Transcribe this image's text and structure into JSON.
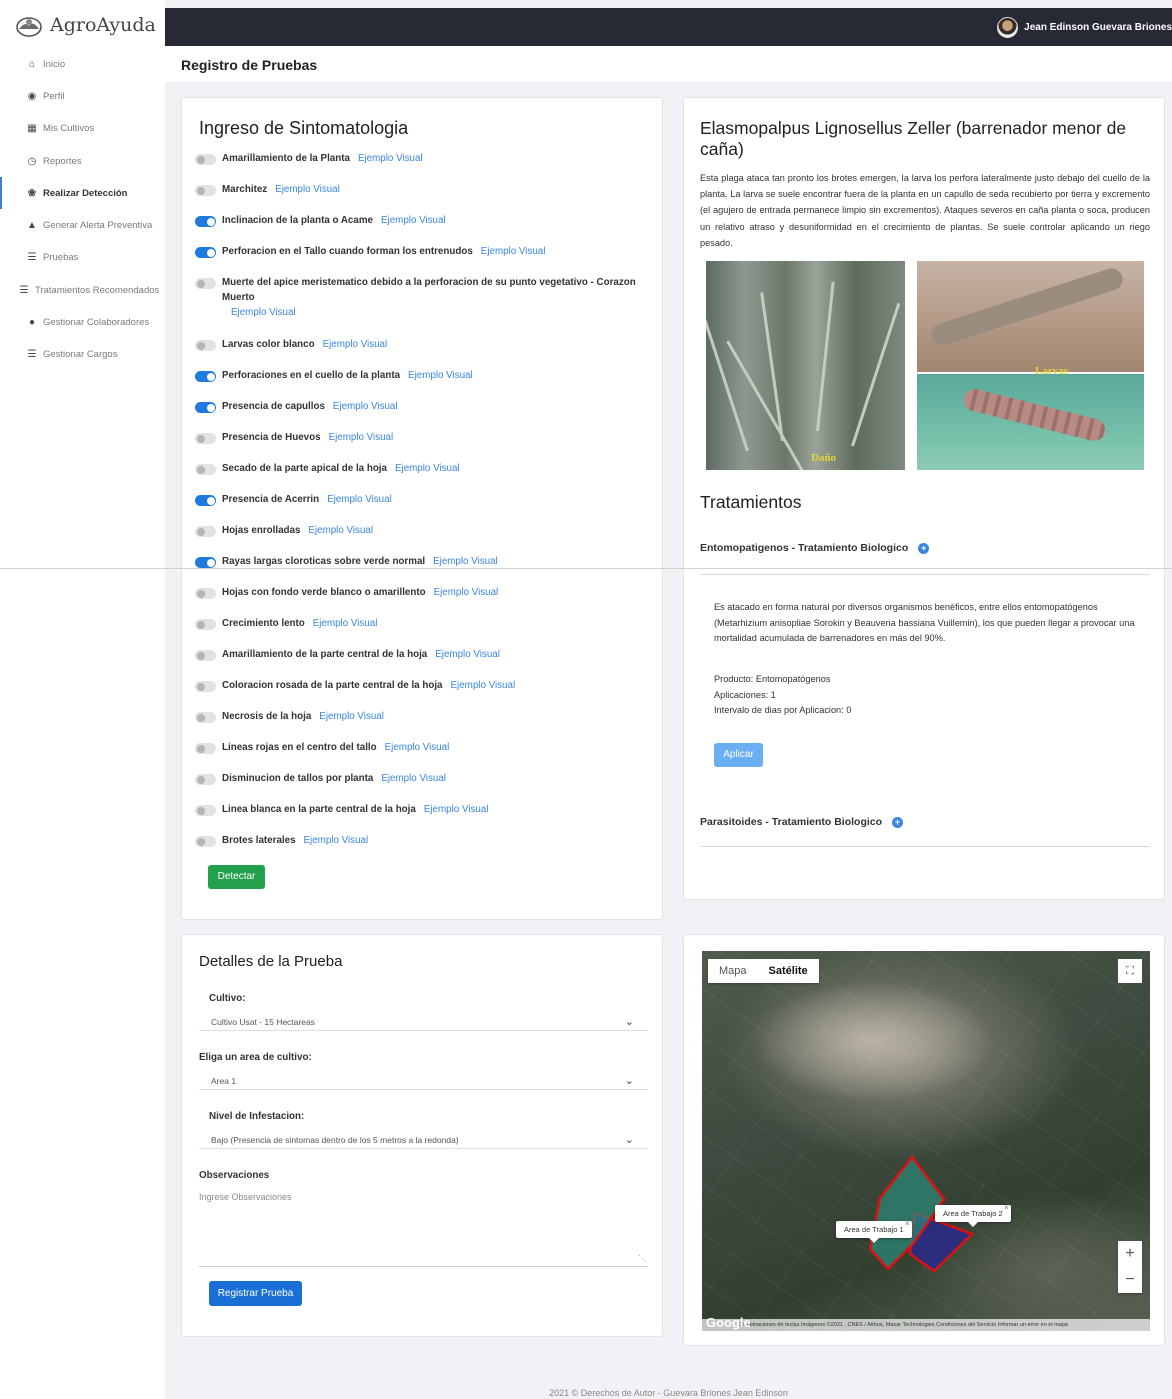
{
  "app": {
    "name": "AgroAyuda"
  },
  "user": {
    "name": "Jean Edinson Guevara Briones"
  },
  "sidebar": {
    "items": [
      {
        "label": "Inicio",
        "icon": "home-icon"
      },
      {
        "label": "Perfil",
        "icon": "user-circle-icon"
      },
      {
        "label": "Mis Cultivos",
        "icon": "map-icon"
      },
      {
        "label": "Reportes",
        "icon": "clock-icon"
      },
      {
        "label": "Realizar Detección",
        "icon": "bug-icon",
        "active": true
      },
      {
        "label": "Generar Alerta Preventiva",
        "icon": "bell-icon"
      },
      {
        "label": "Pruebas",
        "icon": "list-icon"
      },
      {
        "label": "Tratamientos Recomendados",
        "icon": "list-icon"
      },
      {
        "label": "Gestionar Colaboradores",
        "icon": "user-icon"
      },
      {
        "label": "Gestionar Cargos",
        "icon": "list-icon"
      }
    ]
  },
  "page": {
    "title": "Registro de Pruebas"
  },
  "symptoms": {
    "title": "Ingreso de Sintomatologia",
    "link_label": "Ejemplo Visual",
    "items": [
      {
        "label": "Amarillamiento de la Planta",
        "on": false
      },
      {
        "label": "Marchitez",
        "on": false
      },
      {
        "label": "Inclinacion de la planta o Acame",
        "on": true
      },
      {
        "label": "Perforacion en el Tallo cuando forman los entrenudos",
        "on": true
      },
      {
        "label": "Muerte del apice meristematico debido a la perforacion de su punto vegetativo - Corazon Muerto",
        "on": false
      },
      {
        "label": "Larvas color blanco",
        "on": false
      },
      {
        "label": "Perforaciones en el cuello de la planta",
        "on": true
      },
      {
        "label": "Presencia de capullos",
        "on": true
      },
      {
        "label": "Presencia de Huevos",
        "on": false
      },
      {
        "label": "Secado de la parte apical de la hoja",
        "on": false
      },
      {
        "label": "Presencia de Acerrin",
        "on": true
      },
      {
        "label": "Hojas enrolladas",
        "on": false
      },
      {
        "label": "Rayas largas cloroticas sobre verde normal",
        "on": true
      },
      {
        "label": "Hojas con fondo verde blanco o amarillento",
        "on": false
      },
      {
        "label": "Crecimiento lento",
        "on": false
      },
      {
        "label": "Amarillamiento de la parte central de la hoja",
        "on": false
      },
      {
        "label": "Coloracion rosada de la parte central de la hoja",
        "on": false
      },
      {
        "label": "Necrosis de la hoja",
        "on": false
      },
      {
        "label": "Lineas rojas en el centro del tallo",
        "on": false
      },
      {
        "label": "Disminucion de tallos por planta",
        "on": false
      },
      {
        "label": "Linea blanca en la parte central de la hoja",
        "on": false
      },
      {
        "label": "Brotes laterales",
        "on": false
      }
    ],
    "detect_label": "Detectar"
  },
  "pest": {
    "title": "Elasmopalpus Lignosellus Zeller (barrenador menor de caña)",
    "description": "Esta plaga ataca tan pronto los brotes emergen, la larva los perfora lateralmente justo debajo del cuello de la planta. La larva se suele encontrar fuera de la planta en un capullo de seda recubierto por tierra y excremento (el agujero de entrada permanece limpio sin excrementos). Ataques severos en caña planta o soca, producen un relativo atraso y desuniformidad en el crecimiento de plantas. Se suele controlar aplicando un riego pesado.",
    "photo_labels": {
      "damage": "Daño",
      "larvae": "Larvas"
    },
    "treatments_title": "Tratamientos",
    "treatments": [
      {
        "name": "Entomopatigenos - Tratamiento Biologico",
        "body": "Es atacado en forma natural por diversos organismos benéficos, entre ellos entomopatógenos (Metarhizium anisopliae Sorokin y Beauveria bassiana Vuillemin), los que pueden llegar a provocar una mortalidad acumulada de barrenadores en más del 90%.",
        "producto": "Producto: Entomopatógenos",
        "aplicaciones": "Aplicaciones: 1",
        "intervalo": "Intervalo de dias por Aplicacion: 0",
        "apply_label": "Aplicar"
      },
      {
        "name": "Parasitoides - Tratamiento Biologico"
      }
    ]
  },
  "details": {
    "title": "Detalles de la Prueba",
    "cultivo_label": "Cultivo:",
    "cultivo_value": "Cultivo Usat - 15 Hectareas",
    "area_label": "Eliga un area de cultivo:",
    "area_value": "Area 1",
    "nivel_label": "Nivel de Infestacion:",
    "nivel_value": "Bajo (Presencia de sintomas dentro de los 5 metros a la redonda)",
    "obs_label": "Observaciones",
    "obs_placeholder": "Ingrese Observaciones",
    "submit_label": "Registrar Prueba"
  },
  "map": {
    "tab_map": "Mapa",
    "tab_satellite": "Satélite",
    "zoom_in": "+",
    "zoom_out": "−",
    "google": "Google",
    "attribution": "Combinaciones de teclas   Imágenes ©2021 , CNES / Airbus, Maxar Technologies   Condiciones del Servicio   Informar un error en el mapa",
    "area1": "Area de Trabajo 1",
    "area2": "Area de Trabajo 2"
  },
  "footer": {
    "text": "2021 © Derechos de Autor - Guevara Briones Jean Edinson"
  }
}
